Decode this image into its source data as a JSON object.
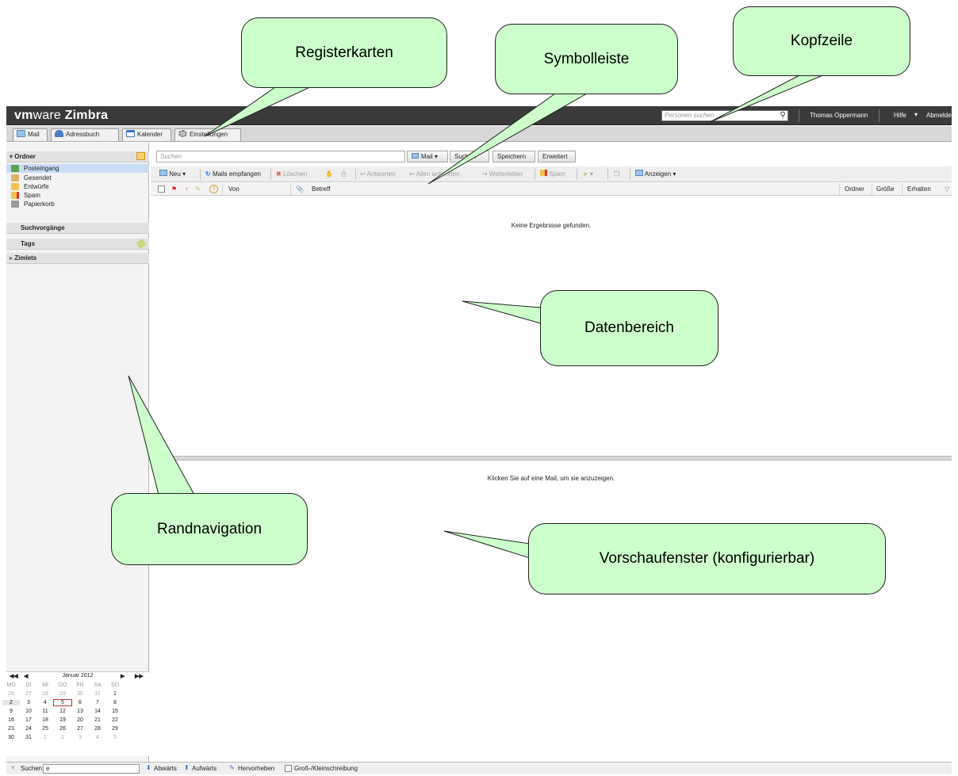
{
  "header": {
    "logo_vm": "vm",
    "logo_ware": "ware",
    "logo_product": "Zimbra",
    "people_search_placeholder": "Personen suchen",
    "user_name": "Thomas Oppermann",
    "help_label": "Hilfe",
    "logout_label": "Abmelden"
  },
  "tabs": [
    {
      "label": "Mail",
      "icon": "mail-icon"
    },
    {
      "label": "Adressbuch",
      "icon": "contacts-icon"
    },
    {
      "label": "Kalender",
      "icon": "calendar-icon"
    },
    {
      "label": "Einstellungen",
      "icon": "gear-icon"
    }
  ],
  "sidebar": {
    "folders_header": "Ordner",
    "folders": [
      {
        "label": "Posteingang",
        "icon": "inbox-icon",
        "selected": true
      },
      {
        "label": "Gesendet",
        "icon": "sent-icon"
      },
      {
        "label": "Entwürfe",
        "icon": "drafts-icon"
      },
      {
        "label": "Spam",
        "icon": "spam-icon"
      },
      {
        "label": "Papierkorb",
        "icon": "trash-icon"
      }
    ],
    "searches_header": "Suchvorgänge",
    "tags_header": "Tags",
    "zimlets_header": "Zimlets"
  },
  "calendar": {
    "month_label": "Januar 2012",
    "weekdays": [
      "MO",
      "DI",
      "MI",
      "DO",
      "FR",
      "SA",
      "SO"
    ],
    "weeks": [
      [
        "26",
        "27",
        "28",
        "29",
        "30",
        "31",
        "1"
      ],
      [
        "2",
        "3",
        "4",
        "5",
        "6",
        "7",
        "8"
      ],
      [
        "9",
        "10",
        "11",
        "12",
        "13",
        "14",
        "15"
      ],
      [
        "16",
        "17",
        "18",
        "19",
        "20",
        "21",
        "22"
      ],
      [
        "23",
        "24",
        "25",
        "26",
        "27",
        "28",
        "29"
      ],
      [
        "30",
        "31",
        "1",
        "2",
        "3",
        "4",
        "5"
      ]
    ],
    "today": "5"
  },
  "search": {
    "placeholder": "Suchen",
    "type_label": "Mail",
    "search_button": "Suchen",
    "save_button": "Speichern",
    "advanced_button": "Erweitert"
  },
  "toolbar": {
    "new": "Neu",
    "get_mail": "Mails empfangen",
    "delete": "Löschen",
    "reply": "Antworten",
    "reply_all": "Allen antworten",
    "forward": "Weiterleiten",
    "spam": "Spam",
    "view": "Anzeigen"
  },
  "columns": {
    "from": "Von",
    "subject": "Betreff",
    "folder": "Ordner",
    "size": "Größe",
    "received": "Erhalten"
  },
  "messages": {
    "no_results": "Keine Ergebnisse gefunden.",
    "click_to_view": "Klicken Sie auf eine Mail, um sie anzuzeigen."
  },
  "findbar": {
    "label": "Suchen:",
    "value": "e",
    "down": "Abwärts",
    "up": "Aufwärts",
    "highlight": "Hervorheben",
    "match_case": "Groß-/Kleinschreibung"
  },
  "callouts": {
    "tabs": "Registerkarten",
    "toolbar": "Symbolleiste",
    "header": "Kopfzeile",
    "data_area": "Datenbereich",
    "side_nav": "Randnavigation",
    "preview": "Vorschaufenster (konfigurierbar)"
  },
  "colors": {
    "callout_fill": "#ccffcc",
    "header_bg": "#3a3a3a",
    "selection": "#c9dcf5"
  }
}
